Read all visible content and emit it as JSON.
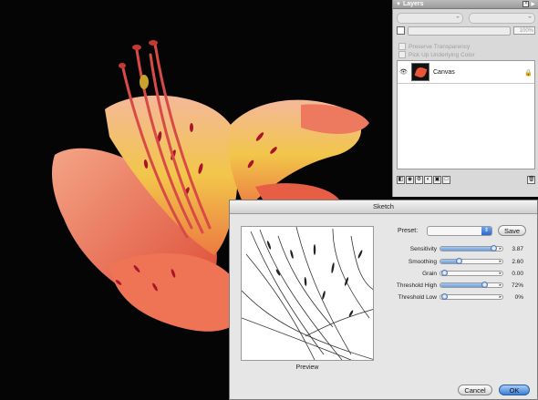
{
  "layers_panel": {
    "title": "Layers",
    "opacity_value": "100%",
    "preserve_transparency_label": "Preserve Transparency",
    "pick_up_underlying_label": "Pick Up Underlying Color",
    "layer_name": "Canvas"
  },
  "dialog": {
    "title": "Sketch",
    "preset_label": "Preset:",
    "preset_value": "",
    "save_label": "Save",
    "preview_label": "Preview",
    "cancel_label": "Cancel",
    "ok_label": "OK",
    "sliders": [
      {
        "label": "Sensitivity",
        "value_text": "3.87",
        "level": 0.86
      },
      {
        "label": "Smoothing",
        "value_text": "2.60",
        "level": 0.3
      },
      {
        "label": "Grain",
        "value_text": "0.00",
        "level": 0.0
      },
      {
        "label": "Threshold High",
        "value_text": "72%",
        "level": 0.72
      },
      {
        "label": "Threshold Low",
        "value_text": "0%",
        "level": 0.0
      }
    ]
  },
  "colors": {
    "canvas_bg": "#050505",
    "petal": "#e8563f",
    "petal_light": "#f3a183",
    "throat": "#f1c43a",
    "accent_blue": "#3a7ed6"
  }
}
